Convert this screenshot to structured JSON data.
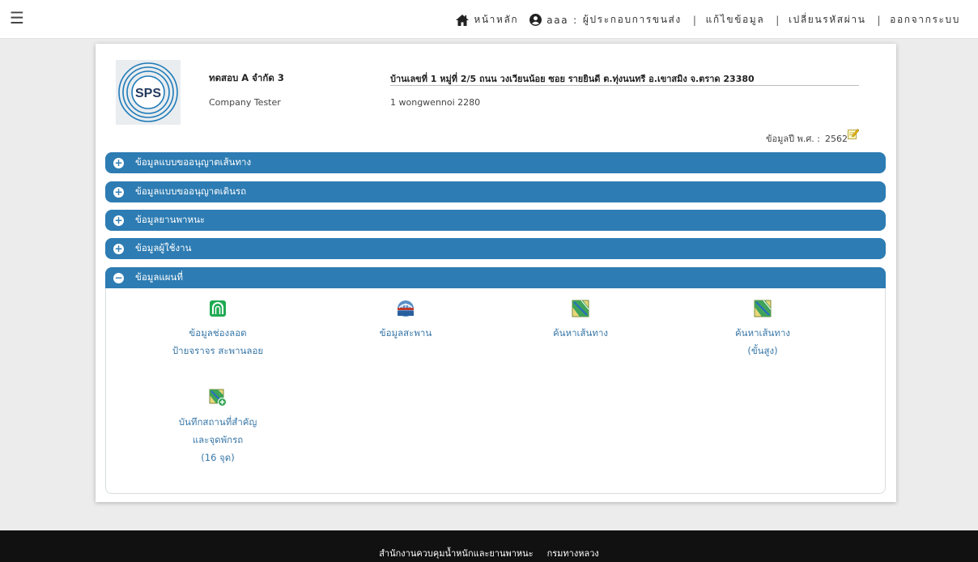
{
  "topbar": {
    "menu_icon": "hamburger-menu-icon",
    "home_label": "หน้าหลัก",
    "user_name": "aaa",
    "user_role": "ผู้ประกอบการขนส่ง",
    "edit_profile_label": "แก้ไขข้อมูล",
    "change_password_label": "เปลี่ยนรหัสผ่าน",
    "logout_label": "ออกจากระบบ",
    "separator": "|",
    "colon": ":"
  },
  "company": {
    "logo_text": "SPS",
    "name": "ทดสอบ A จำกัด 3",
    "name_en": "Company Tester",
    "address_th": "บ้านเลขที่ 1 หมู่ที่ 2/5 ถนน วงเวียนน้อย ซอย รายยินดี ต.ทุ่งนนทรี อ.เขาสมิง จ.ตราด 23380",
    "address_en": "1 wongwennoi 2280",
    "year_label": "ข้อมูลปี พ.ศ. :",
    "year_value": "2562"
  },
  "sections": [
    {
      "label": "ข้อมูลแบบขออนุญาตเส้นทาง",
      "symbol": "+"
    },
    {
      "label": "ข้อมูลแบบขออนุญาตเดินรถ",
      "symbol": "+"
    },
    {
      "label": "ข้อมูลยานพาหนะ",
      "symbol": "+"
    },
    {
      "label": "ข้อมูลผู้ใช้งาน",
      "symbol": "+"
    },
    {
      "label": "ข้อมูลแผนที่",
      "symbol": "−"
    }
  ],
  "map_items": [
    {
      "line1": "ข้อมูลช่องลอด",
      "line2": "ป้ายจราจร สะพานลอย",
      "icon": "tunnel-icon"
    },
    {
      "line1": "ข้อมูลสะพาน",
      "line2": "",
      "icon": "bridge-icon"
    },
    {
      "line1": "ค้นหาเส้นทาง",
      "line2": "",
      "icon": "map-route-icon"
    },
    {
      "line1": "ค้นหาเส้นทาง",
      "line2": "(ขั้นสูง)",
      "icon": "map-route-advanced-icon"
    },
    {
      "line1": "บันทึกสถานที่สำคัญ",
      "line2": "และจุดพักรถ",
      "line3": "(16 จุด)",
      "icon": "map-add-icon"
    }
  ],
  "footer": {
    "org": "สำนักงานควบคุมน้ำหนักและยานพาหนะ",
    "dept": "กรมทางหลวง"
  },
  "colors": {
    "accent": "#2d7cb3",
    "link": "#3a78a8",
    "footer_bg": "#111111"
  }
}
